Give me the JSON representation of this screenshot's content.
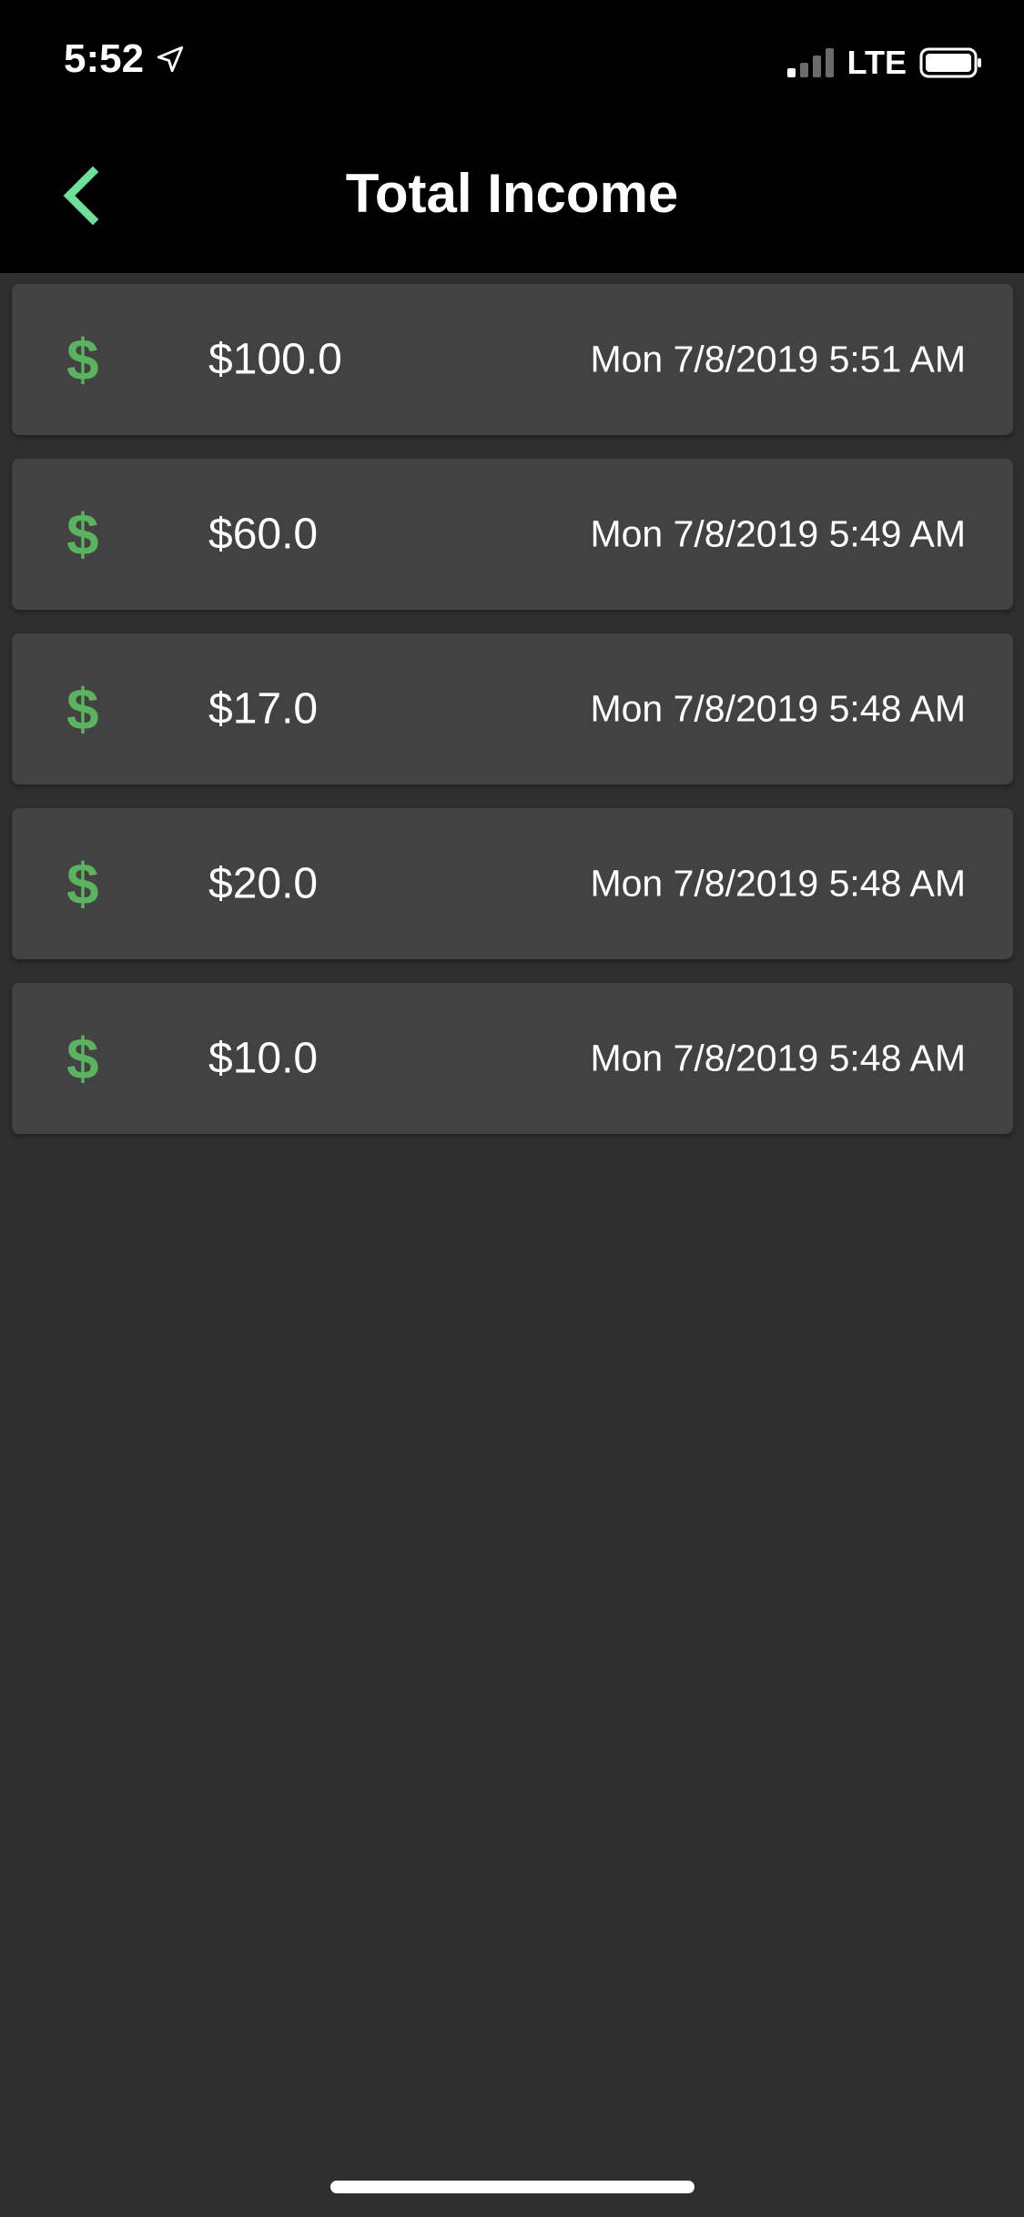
{
  "status_bar": {
    "time": "5:52",
    "network": "LTE",
    "location_icon": "location-arrow-icon",
    "signal_icon": "cell-signal-icon",
    "battery_icon": "battery-full-icon"
  },
  "header": {
    "title": "Total Income",
    "back_icon": "chevron-left-icon"
  },
  "colors": {
    "accent": "#5bb25f",
    "back_arrow": "#6ee09a",
    "card": "#424242",
    "background": "#2f2f2f",
    "header": "#000000"
  },
  "income_items": [
    {
      "icon": "dollar-icon",
      "symbol": "$",
      "amount": "$100.0",
      "timestamp": "Mon 7/8/2019 5:51 AM"
    },
    {
      "icon": "dollar-icon",
      "symbol": "$",
      "amount": "$60.0",
      "timestamp": "Mon 7/8/2019 5:49 AM"
    },
    {
      "icon": "dollar-icon",
      "symbol": "$",
      "amount": "$17.0",
      "timestamp": "Mon 7/8/2019 5:48 AM"
    },
    {
      "icon": "dollar-icon",
      "symbol": "$",
      "amount": "$20.0",
      "timestamp": "Mon 7/8/2019 5:48 AM"
    },
    {
      "icon": "dollar-icon",
      "symbol": "$",
      "amount": "$10.0",
      "timestamp": "Mon 7/8/2019 5:48 AM"
    }
  ]
}
